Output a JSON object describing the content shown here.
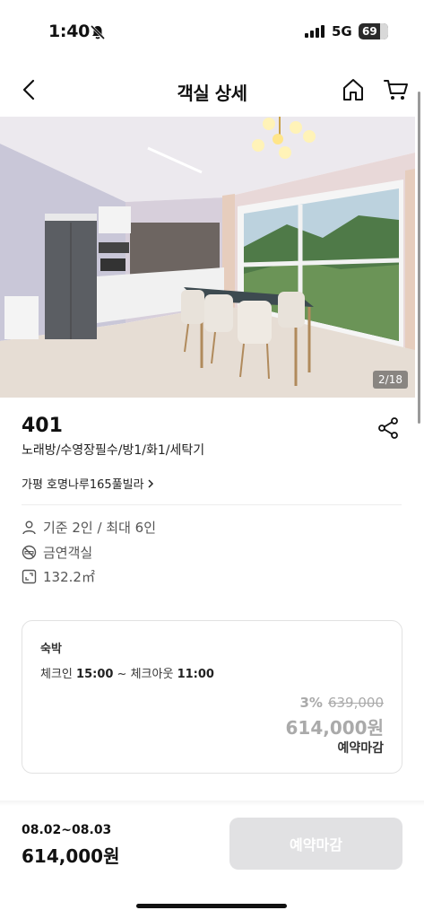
{
  "status_bar": {
    "time": "1:40",
    "network": "5G",
    "battery": "69"
  },
  "header": {
    "title": "객실 상세",
    "icons": [
      "back-icon",
      "home-icon",
      "cart-icon"
    ]
  },
  "photo": {
    "counter": "2/18"
  },
  "room": {
    "name": "401",
    "tags": "노래방/수영장필수/방1/화1/세탁기",
    "property_link": "가평 호명나루165풀빌라",
    "specs": [
      "기준 2인 / 최대 6인",
      "금연객실",
      "132.2㎡"
    ]
  },
  "booking_card": {
    "type": "숙박",
    "checkin_label": "체크인",
    "checkin_time": "15:00",
    "separator": " ~ ",
    "checkout_label": "체크아웃",
    "checkout_time": "11:00",
    "discount": "3%",
    "original_price": "639,000",
    "price": "614,000원",
    "status": "예약마감"
  },
  "bottom_bar": {
    "dates": "08.02~08.03",
    "price": "614,000원",
    "button_label": "예약마감"
  },
  "colors": {
    "disabled_button": "#e1e1e3",
    "muted_price": "#aaaaaa"
  }
}
